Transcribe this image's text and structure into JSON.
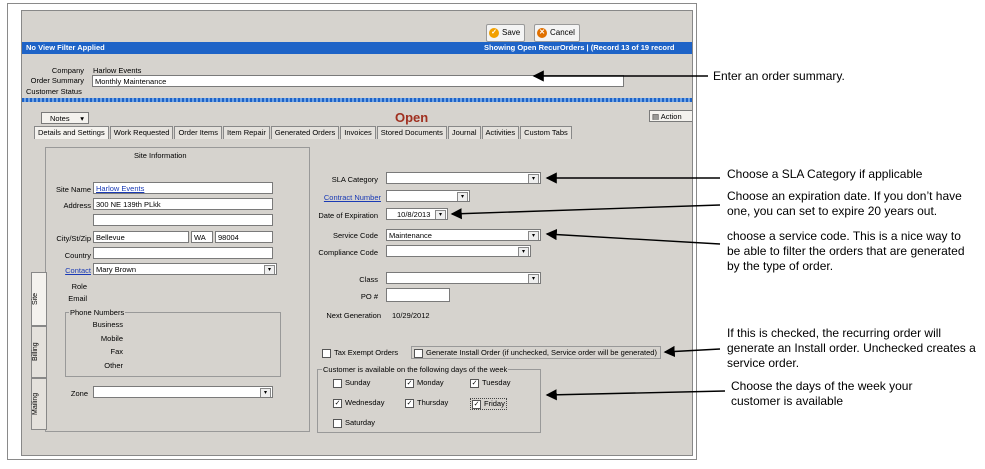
{
  "toolbar": {
    "save": "Save",
    "cancel": "Cancel"
  },
  "status": {
    "left": "No View Filter Applied",
    "right": "Showing Open RecurOrders   |   (Record 13 of 19 record"
  },
  "header": {
    "company_label": "Company",
    "company_value": "Harlow Events",
    "summary_label": "Order Summary",
    "summary_value": "Monthly Maintenance",
    "customer_status_label": "Customer Status"
  },
  "notes_button": "Notes",
  "actions_button": "Action",
  "order_status": "Open",
  "tabs": [
    "Details and Settings",
    "Work Requested",
    "Order Items",
    "Item Repair",
    "Generated Orders",
    "Invoices",
    "Stored Documents",
    "Journal",
    "Activities",
    "Custom Tabs"
  ],
  "site": {
    "heading": "Site Information",
    "site_name_label": "Site Name",
    "site_name": "Harlow Events",
    "address_label": "Address",
    "address": "300 NE 139th PLkk",
    "city_label": "City/St/Zip",
    "city": "Bellevue",
    "state": "WA",
    "zip": "98004",
    "country_label": "Country",
    "contact_label": "Contact",
    "contact": "Mary Brown",
    "role_label": "Role",
    "email_label": "Email",
    "phone_heading": "Phone Numbers",
    "business_label": "Business",
    "mobile_label": "Mobile",
    "fax_label": "Fax",
    "other_label": "Other",
    "zone_label": "Zone"
  },
  "side_tabs": [
    "Site",
    "Billing",
    "Mailing"
  ],
  "right": {
    "sla_label": "SLA Category",
    "contract_label": "Contract Number",
    "expiration_label": "Date of Expiration",
    "expiration_value": "10/8/2013",
    "service_label": "Service Code",
    "service_value": "Maintenance",
    "compliance_label": "Compliance Code",
    "class_label": "Class",
    "po_label": "PO #",
    "nextgen_label": "Next Generation",
    "nextgen_value": "10/29/2012",
    "tax_exempt": "Tax Exempt Orders",
    "gen_install": "Generate Install Order (if unchecked, Service order will be generated)",
    "days_heading": "Customer is available on the following days of the week",
    "days": [
      {
        "label": "Sunday",
        "checked": false
      },
      {
        "label": "Monday",
        "checked": true
      },
      {
        "label": "Tuesday",
        "checked": true
      },
      {
        "label": "Wednesday",
        "checked": true
      },
      {
        "label": "Thursday",
        "checked": true
      },
      {
        "label": "Friday",
        "checked": true
      },
      {
        "label": "Saturday",
        "checked": false
      }
    ]
  },
  "annotations": {
    "summary": "Enter an order summary.",
    "sla": "Choose a SLA Category if applicable",
    "expiration": "Choose an expiration date. If you don’t have one, you can set to expire 20 years out.",
    "service": "choose a service code. This is a nice way to be able to filter the orders that are generated by the type of order.",
    "install": "If this is checked, the recurring order will generate an Install order. Unchecked creates a service order.",
    "days": "Choose the days of the week your customer is available"
  }
}
